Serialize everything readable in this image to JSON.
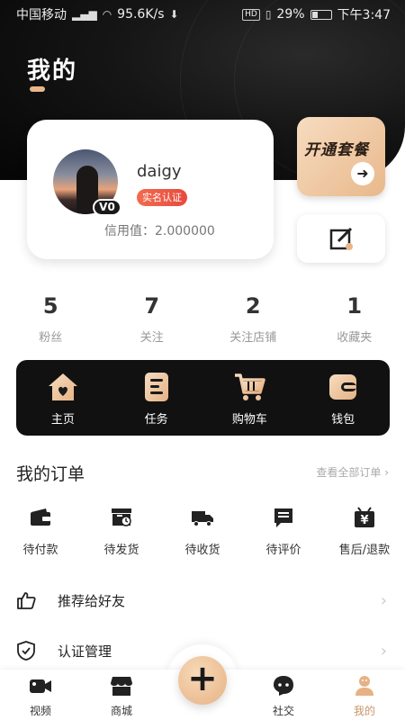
{
  "status_bar": {
    "carrier": "中国移动",
    "network_speed": "95.6K/s",
    "battery": "29%",
    "time": "下午3:47"
  },
  "header": {
    "title": "我的"
  },
  "profile": {
    "username": "daigy",
    "level": "V0",
    "verified_label": "实名认证",
    "credit": "信用值：2.000000"
  },
  "plan_card": {
    "label": "开通套餐"
  },
  "stats": [
    {
      "value": "5",
      "label": "粉丝"
    },
    {
      "value": "7",
      "label": "关注"
    },
    {
      "value": "2",
      "label": "关注店铺"
    },
    {
      "value": "1",
      "label": "收藏夹"
    }
  ],
  "quick_menu": [
    {
      "label": "主页",
      "icon": "home-icon"
    },
    {
      "label": "任务",
      "icon": "task-icon"
    },
    {
      "label": "购物车",
      "icon": "cart-icon"
    },
    {
      "label": "钱包",
      "icon": "wallet-icon"
    }
  ],
  "orders": {
    "title": "我的订单",
    "view_all": "查看全部订单 ›",
    "items": [
      {
        "label": "待付款",
        "icon": "wallet-icon"
      },
      {
        "label": "待发货",
        "icon": "package-clock-icon"
      },
      {
        "label": "待收货",
        "icon": "truck-icon"
      },
      {
        "label": "待评价",
        "icon": "comment-icon"
      },
      {
        "label": "售后/退款",
        "icon": "refund-icon"
      }
    ]
  },
  "list": [
    {
      "label": "推荐给好友",
      "icon": "thumbs-up-icon"
    },
    {
      "label": "认证管理",
      "icon": "shield-check-icon"
    }
  ],
  "tabs": [
    {
      "label": "视频",
      "icon": "video-icon"
    },
    {
      "label": "商城",
      "icon": "shop-icon"
    },
    {
      "label": "社交",
      "icon": "chat-icon"
    },
    {
      "label": "我的",
      "icon": "profile-icon",
      "active": true
    }
  ],
  "colors": {
    "accent_gold": "#e7b689",
    "badge_red": "#e84a3e",
    "active_tab": "#c9956a"
  }
}
